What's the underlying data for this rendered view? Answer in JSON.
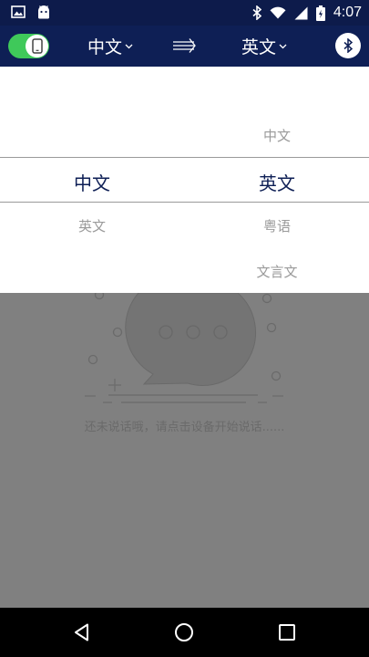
{
  "status_bar": {
    "time": "4:07",
    "icons": [
      "image-icon",
      "android-icon",
      "bluetooth-icon",
      "wifi-icon",
      "signal-icon",
      "battery-icon"
    ]
  },
  "toolbar": {
    "source_language": "中文",
    "target_language": "英文",
    "device_toggle_on": true
  },
  "picker": {
    "left_column": {
      "items": [
        "中文",
        "英文"
      ],
      "selected": "中文"
    },
    "right_column": {
      "items": [
        "中文",
        "英文",
        "粤语",
        "文言文"
      ],
      "selected": "英文"
    }
  },
  "empty_state": {
    "message": "还未说话哦，请点击设备开始说话......"
  },
  "colors": {
    "toolbar": "#0e1f55",
    "status_bar": "#0d1b4b",
    "toggle_on": "#3fc95a",
    "scrim": "#808080"
  }
}
